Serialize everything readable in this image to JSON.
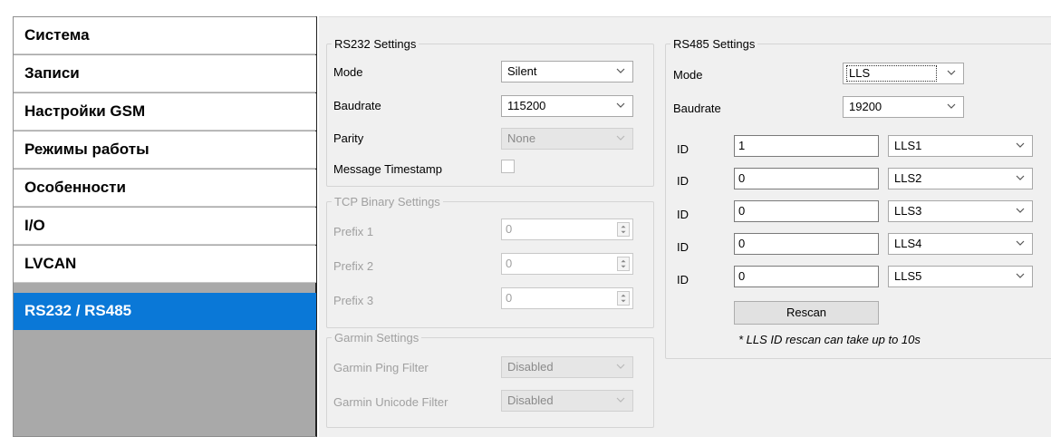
{
  "nav": {
    "items": [
      {
        "label": "Система",
        "active": false
      },
      {
        "label": "Записи",
        "active": false
      },
      {
        "label": "Настройки GSM",
        "active": false
      },
      {
        "label": "Режимы работы",
        "active": false
      },
      {
        "label": "Особенности",
        "active": false
      },
      {
        "label": "I/O",
        "active": false
      },
      {
        "label": "LVCAN",
        "active": false
      },
      {
        "label": "RS232 / RS485",
        "active": true
      }
    ]
  },
  "rs232": {
    "title": "RS232 Settings",
    "mode_label": "Mode",
    "mode_value": "Silent",
    "baudrate_label": "Baudrate",
    "baudrate_value": "115200",
    "parity_label": "Parity",
    "parity_value": "None",
    "timestamp_label": "Message Timestamp",
    "timestamp_checked": false
  },
  "tcp": {
    "title": "TCP Binary Settings",
    "prefix1_label": "Prefix 1",
    "prefix1_value": "0",
    "prefix2_label": "Prefix 2",
    "prefix2_value": "0",
    "prefix3_label": "Prefix 3",
    "prefix3_value": "0"
  },
  "garmin": {
    "title": "Garmin Settings",
    "ping_label": "Garmin Ping Filter",
    "ping_value": "Disabled",
    "unicode_label": "Garmin Unicode Filter",
    "unicode_value": "Disabled"
  },
  "rs485": {
    "title": "RS485 Settings",
    "mode_label": "Mode",
    "mode_value": "LLS",
    "baudrate_label": "Baudrate",
    "baudrate_value": "19200",
    "id_label": "ID",
    "sensors": [
      {
        "id": "1",
        "name": "LLS1"
      },
      {
        "id": "0",
        "name": "LLS2"
      },
      {
        "id": "0",
        "name": "LLS3"
      },
      {
        "id": "0",
        "name": "LLS4"
      },
      {
        "id": "0",
        "name": "LLS5"
      }
    ],
    "rescan_label": "Rescan",
    "note": "* LLS ID rescan can take up to 10s"
  },
  "icons": {
    "dropdown": "chevron-down-icon",
    "spinner": "spin-up-down-icon"
  },
  "colors": {
    "nav_active": "#0a78d7",
    "panel_bg": "#f0f0f0",
    "disabled_text": "#a0a0a0"
  }
}
